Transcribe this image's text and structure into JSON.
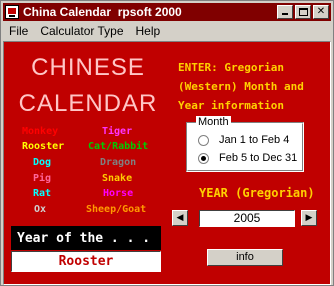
{
  "window": {
    "title": "China Calendar  rpsoft 2000",
    "min_glyph": "",
    "max_glyph": "",
    "close_glyph": "✕"
  },
  "menu": {
    "items": [
      "File",
      "Calculator Type",
      "Help"
    ]
  },
  "left": {
    "title_line1": "CHINESE",
    "title_line2": "CALENDAR",
    "animals": [
      {
        "name": "Monkey",
        "color": "#ff0000"
      },
      {
        "name": "Tiger",
        "color": "#ff33ff"
      },
      {
        "name": "Rooster",
        "color": "#ffff00"
      },
      {
        "name": "Cat/Rabbit",
        "color": "#00cc00"
      },
      {
        "name": "Dog",
        "color": "#00ffff"
      },
      {
        "name": "Dragon",
        "color": "#808080"
      },
      {
        "name": "Pig",
        "color": "#ff6699"
      },
      {
        "name": "Snake",
        "color": "#ffcc00"
      },
      {
        "name": "Rat",
        "color": "#00ffff"
      },
      {
        "name": "Horse",
        "color": "#ff00ff"
      },
      {
        "name": "Ox",
        "color": "#d0d0d0"
      },
      {
        "name": "Sheep/Goat",
        "color": "#ff9900"
      }
    ],
    "year_of_label": "Year of the . . .",
    "result": "Rooster"
  },
  "right": {
    "enter_text": "ENTER: Gregorian (Western) Month and Year information",
    "month_group": {
      "legend": "Month",
      "options": [
        {
          "label": "Jan 1 to Feb 4",
          "checked": false
        },
        {
          "label": "Feb 5 to Dec 31",
          "checked": true
        }
      ]
    },
    "year_label": "YEAR (Gregorian)",
    "year_value": "2005",
    "prev_glyph": "◀",
    "next_glyph": "▶",
    "info_label": "info"
  },
  "colors": {
    "background": "#c00000",
    "title_bar": "#800000",
    "accent_yellow": "#ffd000",
    "title_pink": "#ffc6c6"
  }
}
